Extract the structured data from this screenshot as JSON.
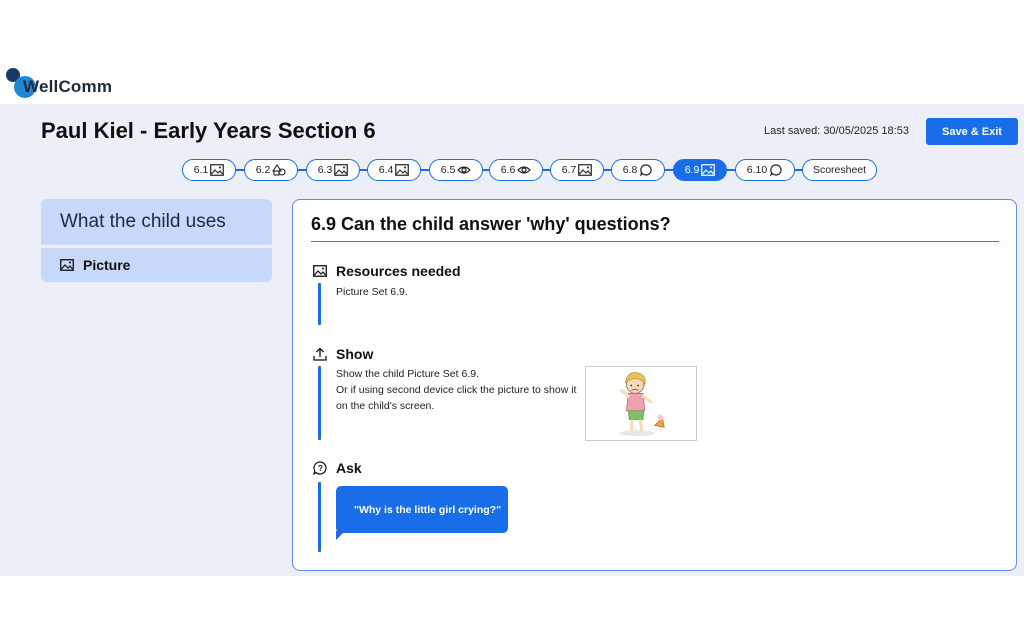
{
  "brand": {
    "name": "WellComm"
  },
  "header": {
    "title": "Paul Kiel - Early Years Section 6",
    "last_saved": "Last saved: 30/05/2025 18:53",
    "save_exit_label": "Save & Exit"
  },
  "steps": [
    {
      "label": "6.1",
      "icon": "picture-icon"
    },
    {
      "label": "6.2",
      "icon": "shapes-icon"
    },
    {
      "label": "6.3",
      "icon": "picture-icon"
    },
    {
      "label": "6.4",
      "icon": "picture-icon"
    },
    {
      "label": "6.5",
      "icon": "eye-icon"
    },
    {
      "label": "6.6",
      "icon": "eye-icon"
    },
    {
      "label": "6.7",
      "icon": "picture-icon"
    },
    {
      "label": "6.8",
      "icon": "speech-icon"
    },
    {
      "label": "6.9",
      "icon": "picture-icon",
      "active": true
    },
    {
      "label": "6.10",
      "icon": "speech-icon"
    },
    {
      "label": "Scoresheet"
    }
  ],
  "sidebar": {
    "heading": "What the child uses",
    "items": [
      {
        "label": "Picture",
        "icon": "picture-icon"
      }
    ]
  },
  "card": {
    "title": "6.9 Can the child answer 'why' questions?",
    "resources": {
      "heading": "Resources needed",
      "text": "Picture Set 6.9."
    },
    "show": {
      "heading": "Show",
      "line1": "Show the child Picture Set 6.9.",
      "line2": "Or if using second device click the picture to show it",
      "line3": "on the child's screen."
    },
    "ask": {
      "heading": "Ask",
      "question": "\"Why is the little girl crying?\""
    }
  },
  "colors": {
    "accent": "#1a6de8",
    "panel_bg": "#eceff8",
    "sidebar_bg": "#c7d8fb"
  }
}
